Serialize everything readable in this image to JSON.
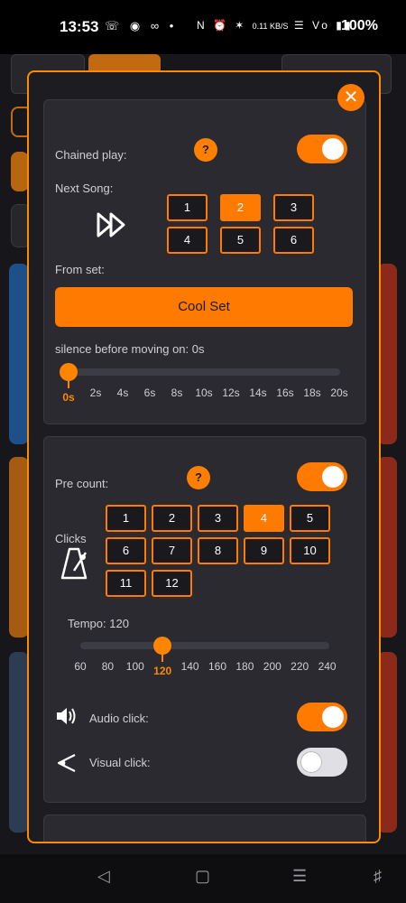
{
  "status_bar": {
    "time": "13:53",
    "network_speed": "0.11 KB/S",
    "battery": "100%"
  },
  "dialog": {
    "close_icon": "close-x",
    "chained": {
      "label": "Chained play:",
      "help": "?",
      "enabled": true,
      "next_song_label": "Next Song:",
      "next_song_icon": "fast-forward",
      "songs": [
        "1",
        "2",
        "3",
        "4",
        "5",
        "6"
      ],
      "selected_song": "2",
      "from_set_label": "From set:",
      "set_button": "Cool Set",
      "silence_label": "silence before moving on: 0s",
      "silence_ticks": [
        "0s",
        "2s",
        "4s",
        "6s",
        "8s",
        "10s",
        "12s",
        "14s",
        "16s",
        "18s",
        "20s"
      ],
      "silence_value": "0s"
    },
    "precount": {
      "label": "Pre count:",
      "help": "?",
      "enabled": true,
      "clicks_label": "Clicks",
      "clicks_icon": "metronome",
      "clicks": [
        "1",
        "2",
        "3",
        "4",
        "5",
        "6",
        "7",
        "8",
        "9",
        "10",
        "11",
        "12"
      ],
      "selected_click": "4",
      "tempo_label": "Tempo: 120",
      "tempo_ticks": [
        "60",
        "80",
        "100",
        "120",
        "140",
        "160",
        "180",
        "200",
        "220",
        "240"
      ],
      "tempo_value": "120",
      "audio_click_label": "Audio click:",
      "audio_click_icon": "speaker",
      "audio_click_enabled": true,
      "visual_click_label": "Visual click:",
      "visual_click_icon": "eye-cone",
      "visual_click_enabled": false
    }
  },
  "colors": {
    "accent": "#ff7a00",
    "panel": "#2a2a30",
    "dialog_bg": "#1c1c21"
  }
}
